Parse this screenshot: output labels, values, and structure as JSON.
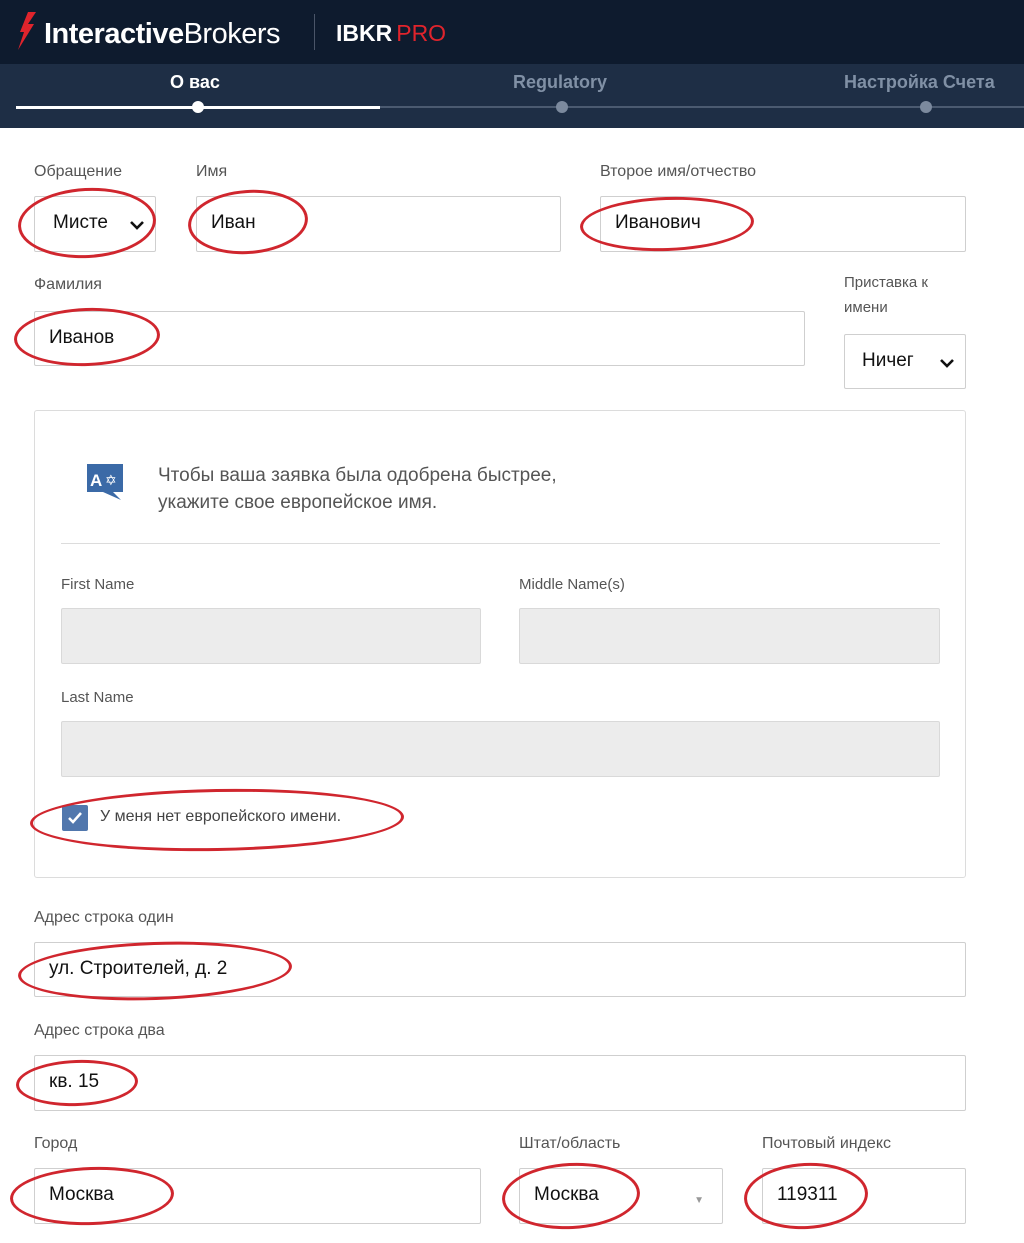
{
  "header": {
    "brand_bold": "Interactive",
    "brand_light": "Brokers",
    "product": "IBKR",
    "product_tier": "PRO"
  },
  "steps": [
    {
      "label": "О вас",
      "state": "active"
    },
    {
      "label": "Regulatory",
      "state": "inactive"
    },
    {
      "label": "Настройка Счета",
      "state": "inactive"
    }
  ],
  "form": {
    "salutation": {
      "label": "Обращение",
      "value": "Мисте"
    },
    "first_name": {
      "label": "Имя",
      "value": "Иван"
    },
    "middle_name": {
      "label": "Второе имя/отчество",
      "value": "Иванович"
    },
    "last_name": {
      "label": "Фамилия",
      "value": "Иванов"
    },
    "name_prefix": {
      "label_line1": "Приставка к",
      "label_line2": "имени",
      "value": "Ничег"
    },
    "european_name": {
      "info_line1": "Чтобы ваша заявка была одобрена быстрее,",
      "info_line2": "укажите свое европейское имя.",
      "first_name_label": "First Name",
      "middle_name_label": "Middle Name(s)",
      "last_name_label": "Last Name",
      "checkbox_label": "У меня нет европейского имени.",
      "checkbox_checked": true
    },
    "address_line1": {
      "label": "Адрес строка один",
      "value": "ул. Строителей, д. 2"
    },
    "address_line2": {
      "label": "Адрес строка два",
      "value": "кв. 15"
    },
    "city": {
      "label": "Город",
      "value": "Москва"
    },
    "state": {
      "label": "Штат/область",
      "value": "Москва"
    },
    "postal_code": {
      "label": "Почтовый индекс",
      "value": "119311"
    }
  },
  "colors": {
    "header_bg": "#0e1b2e",
    "stepbar_bg": "#1e2e45",
    "brand_red": "#e0242c",
    "annotation_red": "#d0262e",
    "checkbox_blue": "#5177ad"
  }
}
